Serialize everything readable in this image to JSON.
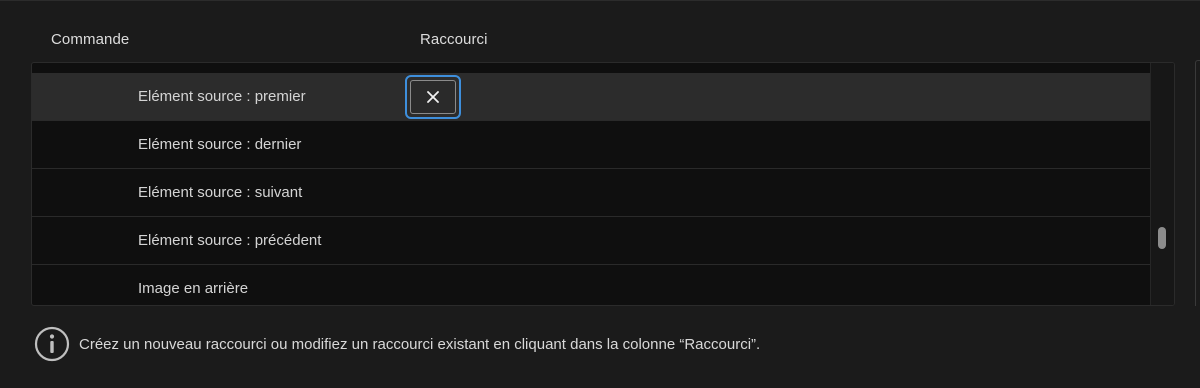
{
  "table": {
    "headers": {
      "command": "Commande",
      "shortcut": "Raccourci"
    },
    "rows": [
      {
        "label": "Elément source : premier",
        "selected": true
      },
      {
        "label": "Elément source : dernier",
        "selected": false
      },
      {
        "label": "Elément source : suivant",
        "selected": false
      },
      {
        "label": "Elément source : précédent",
        "selected": false
      },
      {
        "label": "Image en arrière",
        "selected": false
      }
    ],
    "selected_shortcut_icon": "close-icon"
  },
  "info": {
    "icon": "info-icon",
    "text": "Créez un nouveau raccourci ou modifiez un raccourci existant en cliquant dans la colonne “Raccourci”."
  },
  "colors": {
    "background": "#1b1b1b",
    "table_background": "#0f0f0f",
    "selected_row": "#2c2c2c",
    "focus_ring": "#3e8fdc",
    "text": "#d9d9d9"
  }
}
